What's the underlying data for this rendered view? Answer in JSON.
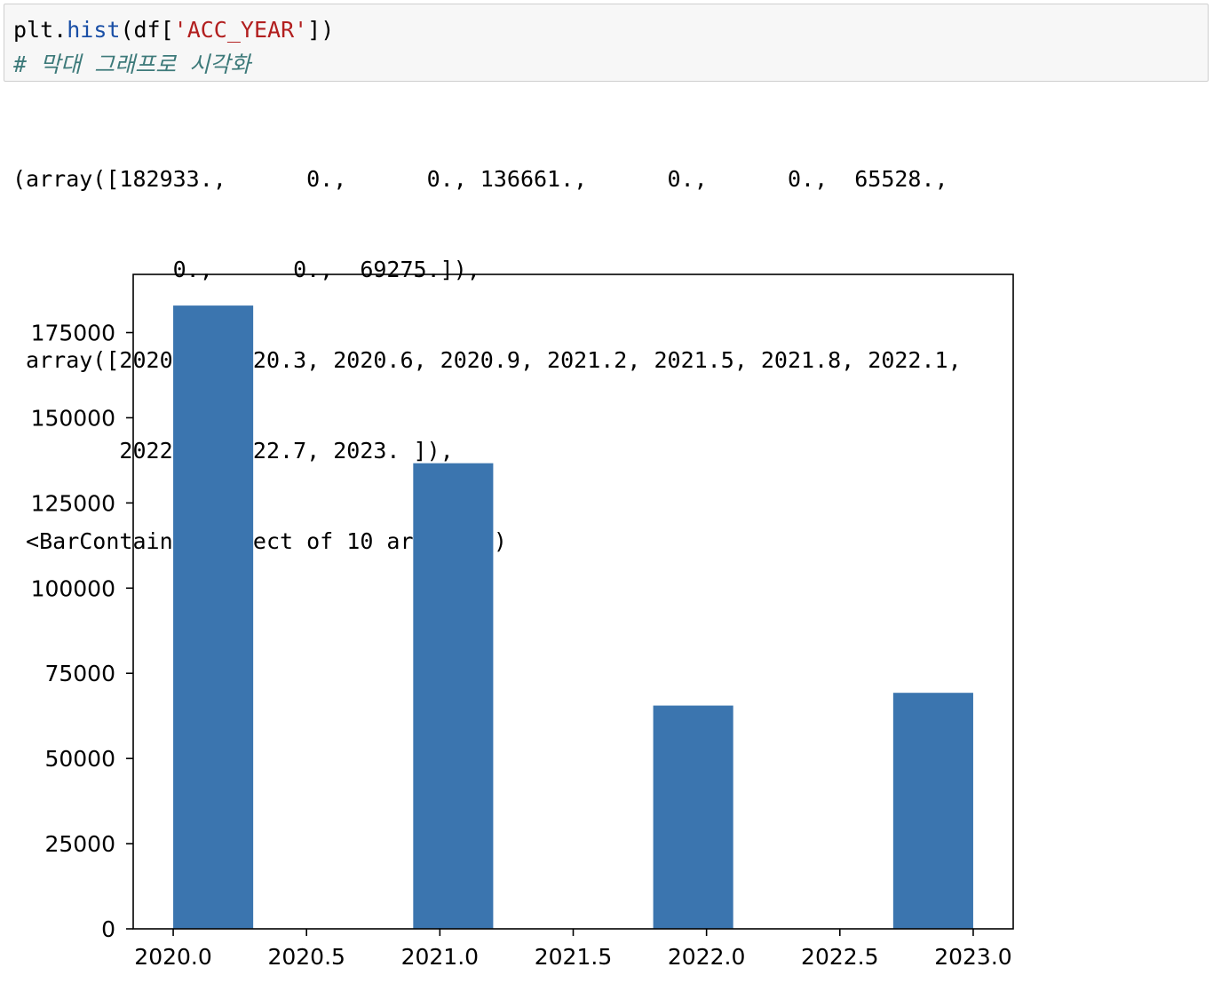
{
  "input_cell": {
    "code_object": "plt.",
    "code_func": "hist",
    "code_open": "(df[",
    "code_string": "'ACC_YEAR'",
    "code_close": "])",
    "comment": "# 막대 그래프로 시각화"
  },
  "output": {
    "lines": [
      "(array([182933.,      0.,      0., 136661.,      0.,      0.,  65528.,",
      "            0.,      0.,  69275.]),",
      " array([2020. , 2020.3, 2020.6, 2020.9, 2021.2, 2021.5, 2021.8, 2022.1,",
      "        2022.4, 2022.7, 2023. ]),",
      " <BarContainer object of 10 artists>)"
    ]
  },
  "chart_data": {
    "type": "bar",
    "title": "",
    "xlabel": "",
    "ylabel": "",
    "bar_color": "#3b75af",
    "bin_edges": [
      2020.0,
      2020.3,
      2020.6,
      2020.9,
      2021.2,
      2021.5,
      2021.8,
      2022.1,
      2022.4,
      2022.7,
      2023.0
    ],
    "values": [
      182933,
      0,
      0,
      136661,
      0,
      0,
      65528,
      0,
      0,
      69275
    ],
    "xlim": [
      2019.85,
      2023.15
    ],
    "ylim": [
      0,
      192080
    ],
    "xticks": [
      2020.0,
      2020.5,
      2021.0,
      2021.5,
      2022.0,
      2022.5,
      2023.0
    ],
    "xtick_labels": [
      "2020.0",
      "2020.5",
      "2021.0",
      "2021.5",
      "2022.0",
      "2022.5",
      "2023.0"
    ],
    "yticks": [
      0,
      25000,
      50000,
      75000,
      100000,
      125000,
      150000,
      175000
    ],
    "ytick_labels": [
      "0",
      "25000",
      "50000",
      "75000",
      "100000",
      "125000",
      "150000",
      "175000"
    ],
    "grid": false,
    "legend": "none"
  }
}
